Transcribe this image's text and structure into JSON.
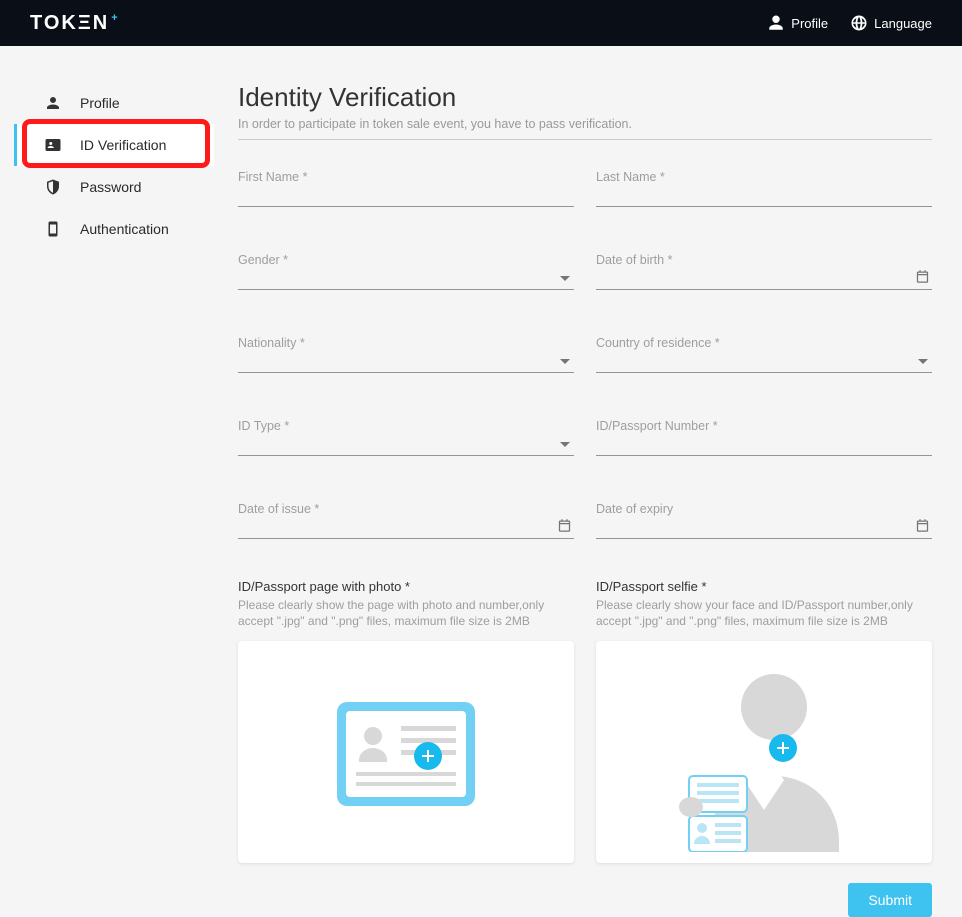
{
  "header": {
    "logo_text": "TOK",
    "logo_e": "Ξ",
    "logo_n": "N",
    "logo_plus": "+",
    "profile": "Profile",
    "language": "Language"
  },
  "sidebar": {
    "items": [
      {
        "label": "Profile"
      },
      {
        "label": "ID Verification"
      },
      {
        "label": "Password"
      },
      {
        "label": "Authentication"
      }
    ]
  },
  "page": {
    "title": "Identity Verification",
    "subtitle": "In order to participate in token sale event, you have to pass verification."
  },
  "form": {
    "first_name": "First Name *",
    "last_name": "Last Name *",
    "gender": "Gender *",
    "dob": "Date of birth *",
    "nationality": "Nationality *",
    "residence": "Country of residence *",
    "id_type": "ID Type *",
    "id_number": "ID/Passport Number *",
    "date_issue": "Date of issue *",
    "date_expiry": "Date of expiry"
  },
  "uploads": {
    "photo_title": "ID/Passport page with photo *",
    "photo_hint": "Please clearly show the page with photo and number,only accept \".jpg\" and \".png\" files, maximum file size is 2MB",
    "selfie_title": "ID/Passport selfie *",
    "selfie_hint": "Please clearly show your face and ID/Passport number,only accept \".jpg\" and \".png\" files, maximum file size is 2MB"
  },
  "actions": {
    "submit": "Submit"
  }
}
